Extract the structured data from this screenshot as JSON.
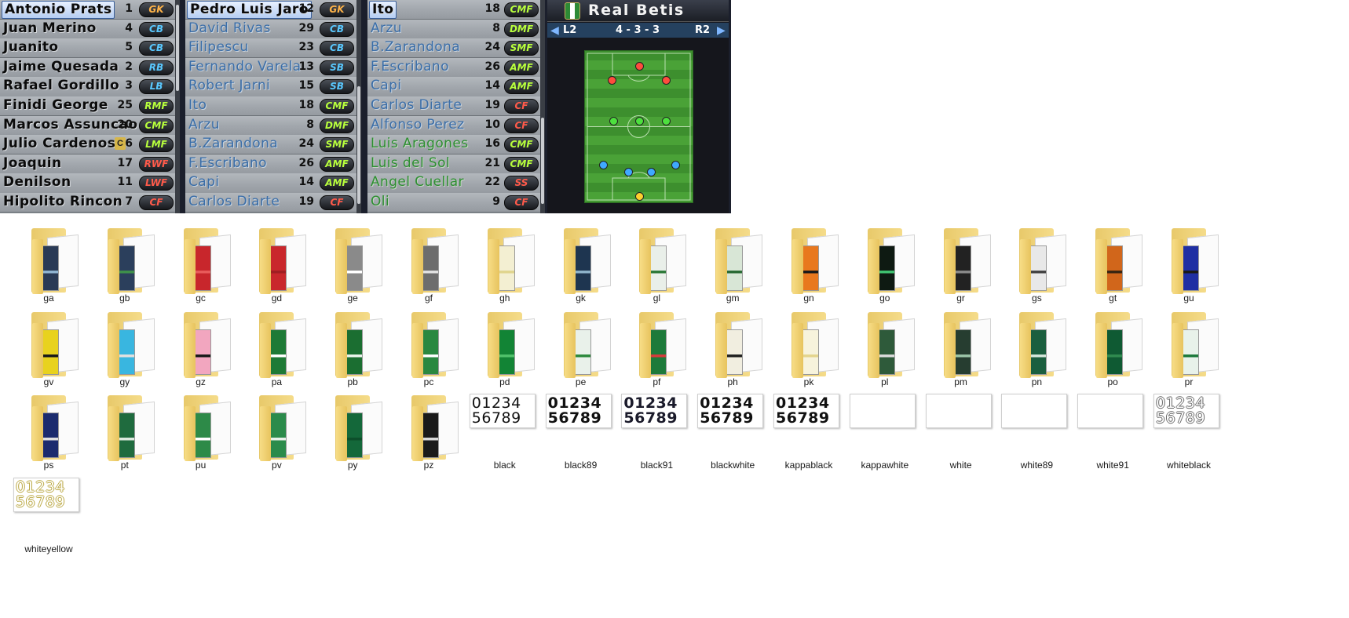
{
  "rosters": [
    [
      {
        "name": "Antonio Prats",
        "num": "1",
        "pos": "GK",
        "cls": "gk",
        "style": "sel"
      },
      {
        "name": "Juan Merino",
        "num": "4",
        "pos": "CB",
        "cls": "df"
      },
      {
        "name": "Juanito",
        "num": "5",
        "pos": "CB",
        "cls": "df"
      },
      {
        "name": "Jaime Quesada",
        "num": "2",
        "pos": "RB",
        "cls": "df"
      },
      {
        "name": "Rafael Gordillo",
        "num": "3",
        "pos": "LB",
        "cls": "df"
      },
      {
        "name": "Finidi George",
        "num": "25",
        "pos": "RMF",
        "cls": "mf"
      },
      {
        "name": "Marcos Assuncao",
        "num": "20",
        "pos": "CMF",
        "cls": "mf"
      },
      {
        "name": "Julio Cardenosa",
        "num": "6",
        "pos": "LMF",
        "cls": "mf",
        "captain": "C"
      },
      {
        "name": "Joaquin",
        "num": "17",
        "pos": "RWF",
        "cls": "fw"
      },
      {
        "name": "Denilson",
        "num": "11",
        "pos": "LWF",
        "cls": "fw"
      },
      {
        "name": "Hipolito Rincon",
        "num": "7",
        "pos": "CF",
        "cls": "fw"
      }
    ],
    [
      {
        "name": "Pedro Luis Jaro",
        "num": "12",
        "pos": "GK",
        "cls": "gk",
        "style": "sel"
      },
      {
        "name": "David Rivas",
        "num": "29",
        "pos": "CB",
        "cls": "df",
        "style": "blue"
      },
      {
        "name": "Filipescu",
        "num": "23",
        "pos": "CB",
        "cls": "df",
        "style": "blue"
      },
      {
        "name": "Fernando Varela",
        "num": "13",
        "pos": "SB",
        "cls": "df",
        "style": "blue"
      },
      {
        "name": "Robert Jarni",
        "num": "15",
        "pos": "SB",
        "cls": "df",
        "style": "blue"
      },
      {
        "name": "Ito",
        "num": "18",
        "pos": "CMF",
        "cls": "mf",
        "style": "blue"
      },
      {
        "name": "Arzu",
        "num": "8",
        "pos": "DMF",
        "cls": "mf",
        "style": "blue"
      },
      {
        "name": "B.Zarandona",
        "num": "24",
        "pos": "SMF",
        "cls": "mf",
        "style": "blue"
      },
      {
        "name": "F.Escribano",
        "num": "26",
        "pos": "AMF",
        "cls": "mf",
        "style": "blue"
      },
      {
        "name": "Capi",
        "num": "14",
        "pos": "AMF",
        "cls": "mf",
        "style": "blue"
      },
      {
        "name": "Carlos Diarte",
        "num": "19",
        "pos": "CF",
        "cls": "fw",
        "style": "blue"
      }
    ],
    [
      {
        "name": "Ito",
        "num": "18",
        "pos": "CMF",
        "cls": "mf",
        "style": "sel"
      },
      {
        "name": "Arzu",
        "num": "8",
        "pos": "DMF",
        "cls": "mf",
        "style": "blue"
      },
      {
        "name": "B.Zarandona",
        "num": "24",
        "pos": "SMF",
        "cls": "mf",
        "style": "blue"
      },
      {
        "name": "F.Escribano",
        "num": "26",
        "pos": "AMF",
        "cls": "mf",
        "style": "blue"
      },
      {
        "name": "Capi",
        "num": "14",
        "pos": "AMF",
        "cls": "mf",
        "style": "blue"
      },
      {
        "name": "Carlos Diarte",
        "num": "19",
        "pos": "CF",
        "cls": "fw",
        "style": "blue"
      },
      {
        "name": "Alfonso Perez",
        "num": "10",
        "pos": "CF",
        "cls": "fw",
        "style": "blue"
      },
      {
        "name": "Luis Aragones",
        "num": "16",
        "pos": "CMF",
        "cls": "mf",
        "style": "green"
      },
      {
        "name": "Luis del Sol",
        "num": "21",
        "pos": "CMF",
        "cls": "mf",
        "style": "green"
      },
      {
        "name": "Angel Cuellar",
        "num": "22",
        "pos": "SS",
        "cls": "fw",
        "style": "green"
      },
      {
        "name": "Oli",
        "num": "9",
        "pos": "CF",
        "cls": "fw",
        "style": "green"
      }
    ]
  ],
  "team": {
    "name": "Real Betis",
    "left_button": "L2",
    "right_button": "R2",
    "formation": "4 - 3 - 3"
  },
  "folders": [
    {
      "label": "ga",
      "tint": "#2a3a55",
      "accent": "#8fb3d0"
    },
    {
      "label": "gb",
      "tint": "#2b3f5c",
      "accent": "#3e8f4a"
    },
    {
      "label": "gc",
      "tint": "#c8262c",
      "accent": "#e85a5a"
    },
    {
      "label": "gd",
      "tint": "#c9272c",
      "accent": "#a01e22"
    },
    {
      "label": "ge",
      "tint": "#8a8a8a",
      "accent": "#ffffff"
    },
    {
      "label": "gf",
      "tint": "#6d6d6d",
      "accent": "#e0e0e0"
    },
    {
      "label": "gh",
      "tint": "#f3efd2",
      "accent": "#e0d58f"
    },
    {
      "label": "gk",
      "tint": "#1e3550",
      "accent": "#8cb1c9"
    },
    {
      "label": "gl",
      "tint": "#e9efe9",
      "accent": "#2e7a3a"
    },
    {
      "label": "gm",
      "tint": "#d8e6d6",
      "accent": "#2b6b36"
    },
    {
      "label": "gn",
      "tint": "#e8781e",
      "accent": "#1a1a1a"
    },
    {
      "label": "go",
      "tint": "#0e1a12",
      "accent": "#3fbf6f"
    },
    {
      "label": "gr",
      "tint": "#222222",
      "accent": "#888888"
    },
    {
      "label": "gs",
      "tint": "#e8e8e8",
      "accent": "#444444"
    },
    {
      "label": "gt",
      "tint": "#d1661b",
      "accent": "#3a2612"
    },
    {
      "label": "gu",
      "tint": "#1f2fa3",
      "accent": "#1a1a1a"
    },
    {
      "label": "gv",
      "tint": "#e8d21e",
      "accent": "#1a1a1a"
    },
    {
      "label": "gy",
      "tint": "#39b6e0",
      "accent": "#e0e0e0"
    },
    {
      "label": "gz",
      "tint": "#f2a6bf",
      "accent": "#1a1a1a"
    },
    {
      "label": "pa",
      "tint": "#1e7a36",
      "accent": "#ffffff"
    },
    {
      "label": "pb",
      "tint": "#1b6e31",
      "accent": "#e9f3ea"
    },
    {
      "label": "pc",
      "tint": "#2a8840",
      "accent": "#ffffff"
    },
    {
      "label": "pd",
      "tint": "#128435",
      "accent": "#4fc16a"
    },
    {
      "label": "pe",
      "tint": "#e9f1ea",
      "accent": "#2e8a3e"
    },
    {
      "label": "pf",
      "tint": "#1d7a3a",
      "accent": "#d43b3b"
    },
    {
      "label": "ph",
      "tint": "#f1eee0",
      "accent": "#222222"
    },
    {
      "label": "pk",
      "tint": "#f7f3dc",
      "accent": "#e4d58e"
    },
    {
      "label": "pl",
      "tint": "#2e5a3a",
      "accent": "#d9d9d9"
    },
    {
      "label": "pm",
      "tint": "#263d30",
      "accent": "#9ac3a6"
    },
    {
      "label": "pn",
      "tint": "#1b5f3f",
      "accent": "#d4e6da"
    },
    {
      "label": "po",
      "tint": "#0f5a33",
      "accent": "#2f8a4f"
    },
    {
      "label": "pr",
      "tint": "#e8f2ea",
      "accent": "#1e7a3c"
    },
    {
      "label": "ps",
      "tint": "#1b2b6e",
      "accent": "#e0e0e0"
    },
    {
      "label": "pt",
      "tint": "#1f6b3e",
      "accent": "#dde9df"
    },
    {
      "label": "pu",
      "tint": "#2d8a48",
      "accent": "#ffffff"
    },
    {
      "label": "pv",
      "tint": "#2b8b4b",
      "accent": "#e8f1ea"
    },
    {
      "label": "py",
      "tint": "#14683a",
      "accent": "#0d4f2b"
    },
    {
      "label": "pz",
      "tint": "#1a1a1a",
      "accent": "#d9d9d9"
    }
  ],
  "numbers": [
    {
      "label": "black",
      "glyphs": "01234\n56789",
      "color": "#111111",
      "weight": "normal",
      "outline": ""
    },
    {
      "label": "black89",
      "glyphs": "01234\n56789",
      "color": "#111111",
      "weight": "bold",
      "outline": ""
    },
    {
      "label": "black91",
      "glyphs": "01234\n56789",
      "color": "#1a1a2a",
      "weight": "bold",
      "outline": ""
    },
    {
      "label": "blackwhite",
      "glyphs": "01234\n56789",
      "color": "#111111",
      "weight": "bold",
      "outline": ""
    },
    {
      "label": "kappablack",
      "glyphs": "01234\n56789",
      "color": "#111111",
      "weight": "bold",
      "outline": ""
    },
    {
      "label": "kappawhite",
      "glyphs": "",
      "color": "#ffffff",
      "weight": "normal",
      "outline": ""
    },
    {
      "label": "white",
      "glyphs": "",
      "color": "#ffffff",
      "weight": "normal",
      "outline": ""
    },
    {
      "label": "white89",
      "glyphs": "",
      "color": "#ffffff",
      "weight": "normal",
      "outline": ""
    },
    {
      "label": "white91",
      "glyphs": "",
      "color": "#ffffff",
      "weight": "normal",
      "outline": ""
    },
    {
      "label": "whiteblack",
      "glyphs": "01234\n56789",
      "color": "#ffffff",
      "weight": "normal",
      "outline": "#666666"
    },
    {
      "label": "whiteyellow",
      "glyphs": "01234\n56789",
      "color": "#ffffff",
      "weight": "normal",
      "outline": "#b9a640"
    }
  ],
  "formation_dots": [
    {
      "role": "fw",
      "fx": 0.5,
      "fy": 0.1
    },
    {
      "role": "fw",
      "fx": 0.25,
      "fy": 0.19
    },
    {
      "role": "fw",
      "fx": 0.75,
      "fy": 0.19
    },
    {
      "role": "mf",
      "fx": 0.26,
      "fy": 0.46
    },
    {
      "role": "mf",
      "fx": 0.5,
      "fy": 0.46
    },
    {
      "role": "mf",
      "fx": 0.75,
      "fy": 0.46
    },
    {
      "role": "df",
      "fx": 0.17,
      "fy": 0.75
    },
    {
      "role": "df",
      "fx": 0.4,
      "fy": 0.8
    },
    {
      "role": "df",
      "fx": 0.61,
      "fy": 0.8
    },
    {
      "role": "df",
      "fx": 0.84,
      "fy": 0.75
    },
    {
      "role": "gk",
      "fx": 0.5,
      "fy": 0.96
    }
  ]
}
